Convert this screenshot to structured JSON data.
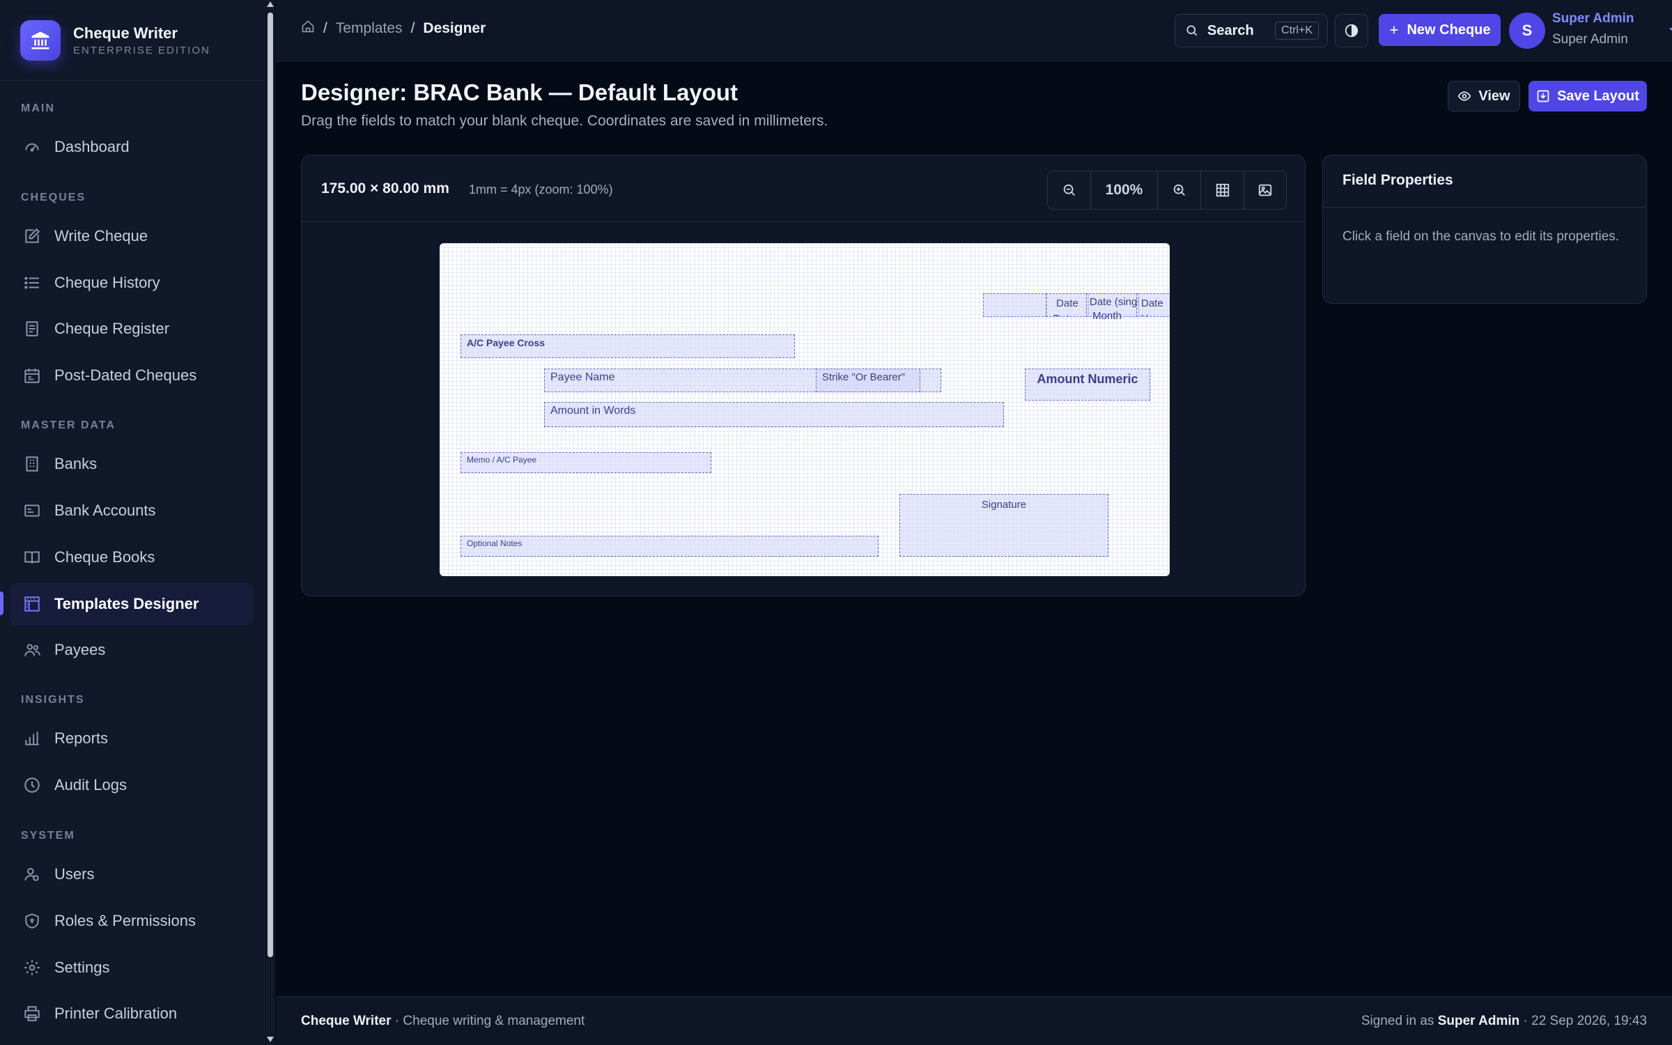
{
  "brand": {
    "name": "Cheque Writer",
    "edition": "ENTERPRISE EDITION"
  },
  "nav": {
    "sections": {
      "main": "MAIN",
      "cheques": "CHEQUES",
      "master": "MASTER DATA",
      "insights": "INSIGHTS",
      "system": "SYSTEM"
    },
    "items": {
      "dashboard": "Dashboard",
      "write": "Write Cheque",
      "history": "Cheque History",
      "register": "Cheque Register",
      "postdated": "Post-Dated Cheques",
      "banks": "Banks",
      "accounts": "Bank Accounts",
      "books": "Cheque Books",
      "templates": "Templates Designer",
      "payees": "Payees",
      "reports": "Reports",
      "audit": "Audit Logs",
      "users": "Users",
      "roles": "Roles & Permissions",
      "settings": "Settings",
      "printer": "Printer Calibration"
    }
  },
  "header": {
    "breadcrumb": {
      "templates": "Templates",
      "current": "Designer",
      "sep": "/"
    },
    "search_label": "Search",
    "search_shortcut": "Ctrl+K",
    "new_cheque": "New Cheque",
    "avatar_initial": "S",
    "user_name": "Super Admin",
    "user_role": "Super Admin"
  },
  "page": {
    "title": "Designer: BRAC Bank — Default Layout",
    "subtitle": "Drag the fields to match your blank cheque. Coordinates are saved in millimeters.",
    "view_label": "View",
    "save_label": "Save Layout"
  },
  "canvas": {
    "dimensions": "175.00 × 80.00 mm",
    "scale": "1mm = 4px (zoom: 100%)",
    "zoom": "100%",
    "fields": {
      "date_box": "",
      "date_day": "Date Date - Day",
      "date_single": "Date (single)",
      "date_month": "Month",
      "date_year": "Date Year",
      "ac_payee_cross": "A/C Payee Cross",
      "payee_name": "Payee Name",
      "strike_bearer": "Strike \"Or Bearer\"",
      "amount_numeric": "Amount Numeric",
      "amount_words": "Amount in Words",
      "memo": "Memo / A/C Payee",
      "signature": "Signature",
      "optional_notes": "Optional Notes"
    }
  },
  "properties": {
    "title": "Field Properties",
    "hint": "Click a field on the canvas to edit its properties."
  },
  "footer": {
    "app": "Cheque Writer",
    "tagline": "· Cheque writing & management",
    "signed_in_prefix": "Signed in as",
    "signed_in_user": "Super Admin",
    "datetime": "· 22 Sep 2026, 19:43"
  },
  "colors": {
    "accent": "#4f46e5",
    "sidebar_bg": "#101829",
    "page_bg": "#050a17"
  }
}
